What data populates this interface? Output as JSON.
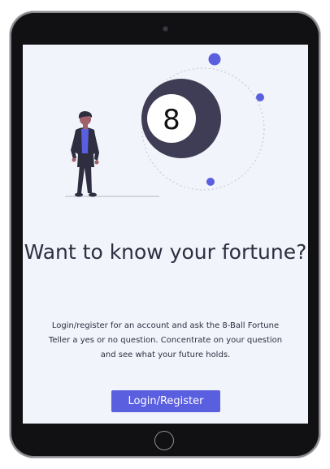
{
  "hero": {
    "ball_label": "8",
    "title": "Want to know your fortune?",
    "description": "Login/register for an account and ask the 8-Ball Fortune Teller a yes or no question. Concentrate on your question and see what your future holds."
  },
  "cta": {
    "label": "Login/Register"
  },
  "colors": {
    "accent": "#5a5fe0",
    "ball": "#3f3d56",
    "text": "#2f2e41",
    "screen_bg": "#f1f4fa",
    "device": "#111113"
  },
  "icons": {
    "ball": "eight-ball-icon",
    "person": "person-illustration",
    "camera": "camera-icon",
    "home": "home-button-icon"
  }
}
